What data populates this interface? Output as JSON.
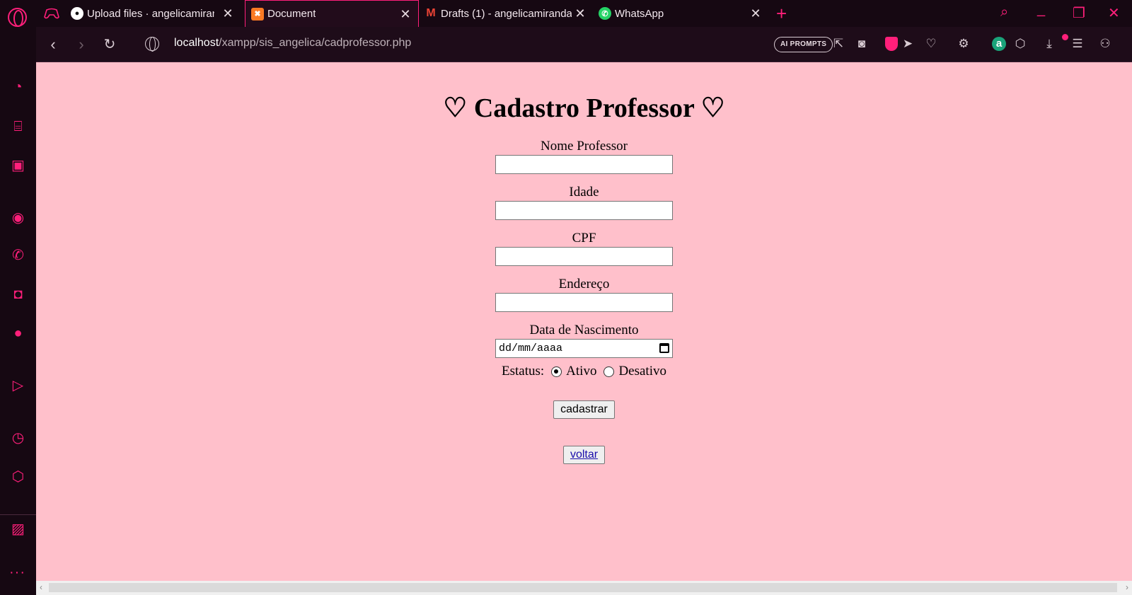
{
  "tabs": [
    {
      "title": "Upload files · angelicamiran",
      "favicon": "github-icon"
    },
    {
      "title": "Document",
      "favicon": "xampp-icon",
      "active": true
    },
    {
      "title": "Drafts (1) - angelicamiranda",
      "favicon": "gmail-icon"
    },
    {
      "title": "WhatsApp",
      "favicon": "whatsapp-icon"
    }
  ],
  "address": {
    "host": "localhost",
    "path": "/xampp/sis_angelica/cadprofessor.php"
  },
  "toolbar": {
    "ai_prompts_label": "AI PROMPTS"
  },
  "colors": {
    "accent": "#ff1f7a",
    "page_background": "#ffc0cb",
    "chrome_background": "#160812"
  },
  "form": {
    "title": "♡ Cadastro Professor ♡",
    "fields": {
      "nome": {
        "label": "Nome Professor",
        "value": ""
      },
      "idade": {
        "label": "Idade",
        "value": ""
      },
      "cpf": {
        "label": "CPF",
        "value": ""
      },
      "endereco": {
        "label": "Endereço",
        "value": ""
      },
      "nascimento": {
        "label": "Data de Nascimento",
        "value": "dd/mm/aaaa"
      }
    },
    "status": {
      "label": "Estatus:",
      "options": [
        "Ativo",
        "Desativo"
      ],
      "selected": "Ativo"
    },
    "submit_label": "cadastrar",
    "back_label": "voltar"
  }
}
